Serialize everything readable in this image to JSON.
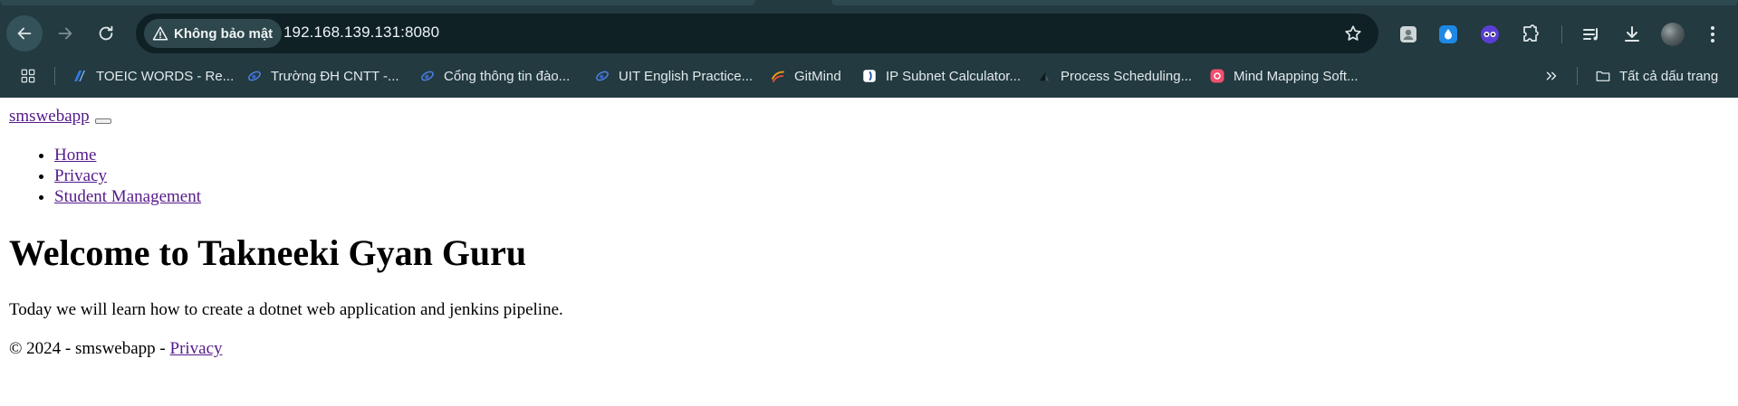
{
  "browser": {
    "security_label": "Không bảo mật",
    "url": "192.168.139.131:8080",
    "icons": {
      "back": "arrow-left-icon",
      "forward": "arrow-right-icon",
      "reload": "reload-icon",
      "star": "star-icon",
      "extensions": "puzzle-icon",
      "reading_list": "reading-list-icon",
      "downloads": "download-icon",
      "menu": "kebab-menu-icon"
    },
    "colors": {
      "frame": "#223a40",
      "omnibox": "#0f2125",
      "text": "#e3e9ea"
    }
  },
  "bookmarks": {
    "items": [
      {
        "label": "TOEIC WORDS - Re..."
      },
      {
        "label": "Trường ĐH CNTT -..."
      },
      {
        "label": "Cổng thông tin đào..."
      },
      {
        "label": "UIT English Practice..."
      },
      {
        "label": "GitMind"
      },
      {
        "label": "IP Subnet Calculator..."
      },
      {
        "label": "Process Scheduling..."
      },
      {
        "label": "Mind Mapping Soft..."
      }
    ],
    "all_bookmarks_label": "Tất cả dấu trang"
  },
  "page": {
    "brand": "smswebapp",
    "nav": {
      "home": "Home",
      "privacy": "Privacy",
      "student_management": "Student Management"
    },
    "heading": "Welcome to Takneeki Gyan Guru",
    "paragraph": "Today we will learn how to create a dotnet web application and jenkins pipeline.",
    "footer": {
      "prefix": "© 2024 - smswebapp - ",
      "privacy_link": "Privacy"
    },
    "colors": {
      "link": "#551a8b",
      "text": "#000000",
      "background": "#ffffff"
    }
  }
}
